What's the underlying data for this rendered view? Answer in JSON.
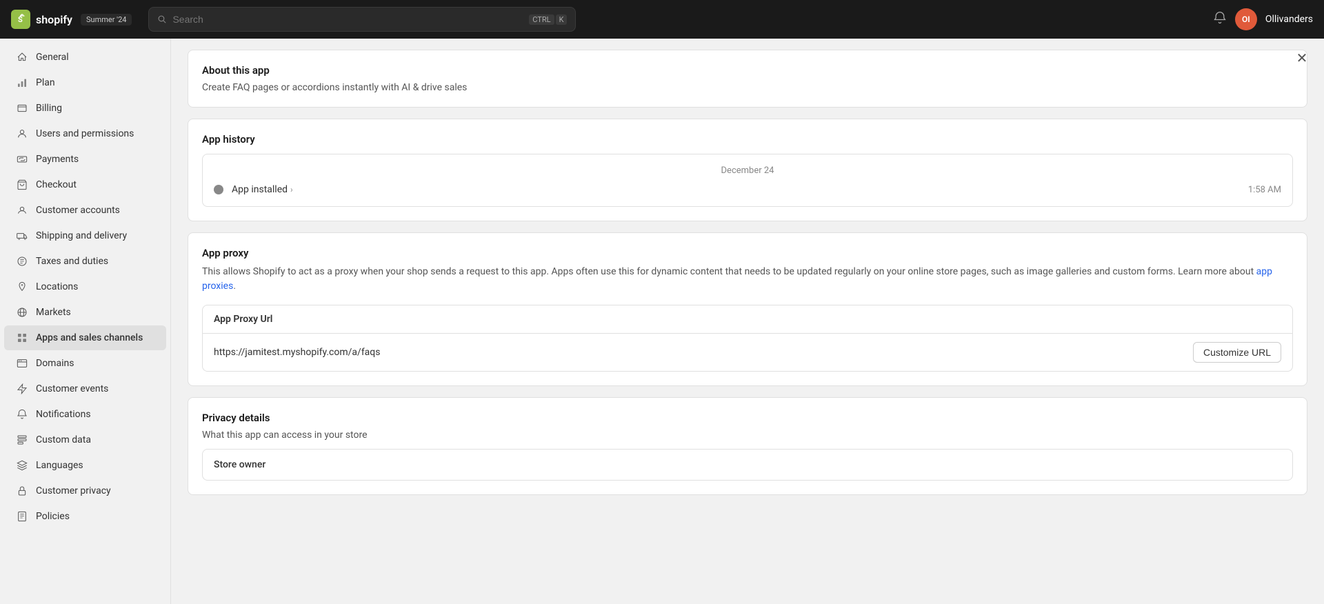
{
  "topnav": {
    "logo_letter": "S",
    "store_badge": "Summer '24",
    "search_placeholder": "Search",
    "shortcut_ctrl": "CTRL",
    "shortcut_k": "K",
    "bell_icon": "bell-icon",
    "avatar_initials": "OI",
    "store_name": "Ollivanders"
  },
  "sidebar": {
    "items": [
      {
        "id": "general",
        "label": "General",
        "icon": "home-icon"
      },
      {
        "id": "plan",
        "label": "Plan",
        "icon": "chart-icon"
      },
      {
        "id": "billing",
        "label": "Billing",
        "icon": "billing-icon"
      },
      {
        "id": "users-permissions",
        "label": "Users and permissions",
        "icon": "user-icon"
      },
      {
        "id": "payments",
        "label": "Payments",
        "icon": "payments-icon"
      },
      {
        "id": "checkout",
        "label": "Checkout",
        "icon": "cart-icon"
      },
      {
        "id": "customer-accounts",
        "label": "Customer accounts",
        "icon": "account-icon"
      },
      {
        "id": "shipping-delivery",
        "label": "Shipping and delivery",
        "icon": "shipping-icon"
      },
      {
        "id": "taxes-duties",
        "label": "Taxes and duties",
        "icon": "tax-icon"
      },
      {
        "id": "locations",
        "label": "Locations",
        "icon": "location-icon"
      },
      {
        "id": "markets",
        "label": "Markets",
        "icon": "markets-icon"
      },
      {
        "id": "apps-sales-channels",
        "label": "Apps and sales channels",
        "icon": "apps-icon",
        "active": true
      },
      {
        "id": "domains",
        "label": "Domains",
        "icon": "domains-icon"
      },
      {
        "id": "customer-events",
        "label": "Customer events",
        "icon": "events-icon"
      },
      {
        "id": "notifications",
        "label": "Notifications",
        "icon": "notification-icon"
      },
      {
        "id": "custom-data",
        "label": "Custom data",
        "icon": "data-icon"
      },
      {
        "id": "languages",
        "label": "Languages",
        "icon": "language-icon"
      },
      {
        "id": "customer-privacy",
        "label": "Customer privacy",
        "icon": "privacy-icon"
      },
      {
        "id": "policies",
        "label": "Policies",
        "icon": "policies-icon"
      }
    ]
  },
  "main": {
    "close_icon": "close-icon",
    "about_app": {
      "title": "About this app",
      "description": "Create FAQ pages or accordions instantly with AI & drive sales"
    },
    "app_history": {
      "title": "App history",
      "date": "December 24",
      "event_label": "App installed",
      "event_time": "1:58 AM"
    },
    "app_proxy": {
      "title": "App proxy",
      "description": "This allows Shopify to act as a proxy when your shop sends a request to this app. Apps often use this for dynamic content that needs to be updated regularly on your online store pages, such as image galleries and custom forms. Learn more about ",
      "link_text": "app proxies",
      "link_suffix": ".",
      "proxy_url_section": {
        "header": "App Proxy Url",
        "url": "https://jamitest.myshopify.com/a/faqs",
        "button_label": "Customize URL"
      }
    },
    "privacy_details": {
      "title": "Privacy details",
      "subtitle": "What this app can access in your store",
      "store_owner_label": "Store owner"
    }
  }
}
